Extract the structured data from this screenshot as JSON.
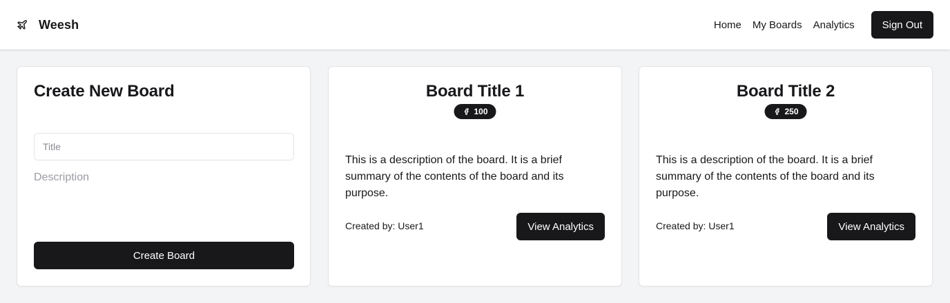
{
  "app": {
    "brand_name": "Weesh",
    "brand_icon": "paper-plane-icon"
  },
  "nav": {
    "links": [
      "Home",
      "My Boards",
      "Analytics"
    ],
    "sign_out_label": "Sign Out"
  },
  "create_form": {
    "heading": "Create New Board",
    "title_placeholder": "Title",
    "title_value": "",
    "description_placeholder": "Description",
    "description_value": "",
    "submit_label": "Create Board"
  },
  "boards": [
    {
      "title": "Board Title 1",
      "badge_icon": "facebook-icon",
      "count": "100",
      "description": "This is a description of the board. It is a brief summary of the contents of the board and its purpose.",
      "created_by": "Created by: User1",
      "button_label": "View Analytics"
    },
    {
      "title": "Board Title 2",
      "badge_icon": "facebook-icon",
      "count": "250",
      "description": "This is a description of the board. It is a brief summary of the contents of the board and its purpose.",
      "created_by": "Created by: User1",
      "button_label": "View Analytics"
    }
  ],
  "colors": {
    "background": "#f3f4f6",
    "primary": "#18181b",
    "card": "#ffffff",
    "border": "#e4e4e7"
  }
}
